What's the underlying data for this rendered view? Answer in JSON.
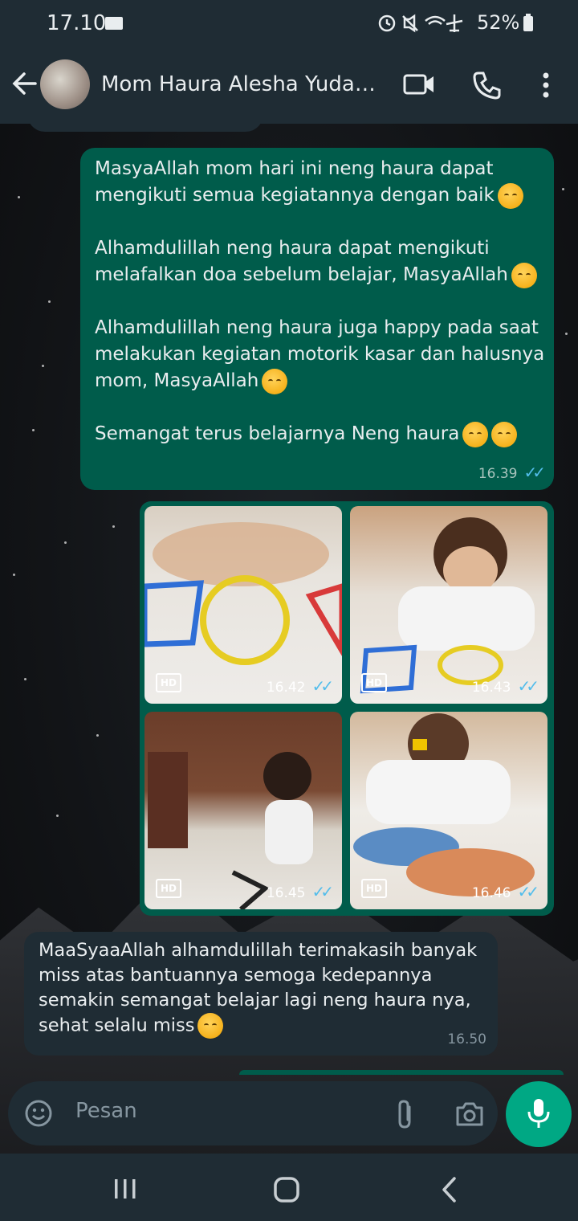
{
  "status_bar": {
    "time": "17.10",
    "battery": "52%",
    "icons": [
      "folder-icon",
      "alarm-icon",
      "mute-icon",
      "wifi-icon",
      "airplane-icon",
      "battery-icon"
    ]
  },
  "header": {
    "title": "Mom Haura Alesha Yudadar...",
    "icons": [
      "back-arrow-icon",
      "video-call-icon",
      "phone-icon",
      "more-vert-icon"
    ]
  },
  "messages": [
    {
      "direction": "outgoing",
      "lines": [
        "MasyaAllah mom hari ini neng haura dapat",
        "mengikuti semua kegiatannya dengan baik",
        "",
        "Alhamdulillah neng haura dapat mengikuti",
        "melafalkan doa sebelum belajar, MasyaAllah",
        "",
        "Alhamdulillah neng haura juga happy pada saat",
        "melakukan kegiatan motorik kasar dan halusnya",
        "mom, MasyaAllah",
        "",
        "Semangat terus belajarnya Neng haura"
      ],
      "time": "16.39"
    },
    {
      "direction": "outgoing",
      "media": [
        {
          "label": "HD",
          "time": "16.42"
        },
        {
          "label": "HD",
          "time": "16.43"
        },
        {
          "label": "HD",
          "time": "16.45"
        },
        {
          "label": "HD",
          "time": "16.46"
        }
      ]
    },
    {
      "direction": "incoming",
      "lines": [
        "MaaSyaaAllah alhamdulillah terimakasih banyak",
        "miss atas bantuannya semoga kedepannya",
        "semakin semangat belajar lagi neng haura nya,",
        "sehat selalu miss"
      ],
      "time": "16.50"
    }
  ],
  "input": {
    "placeholder": "Pesan"
  },
  "colors": {
    "header_bg": "#1f2c34",
    "outgoing_bubble": "#005c4b",
    "incoming_bubble": "#1f2c34",
    "accent": "#00a884",
    "read_ticks": "#53bdeb"
  }
}
